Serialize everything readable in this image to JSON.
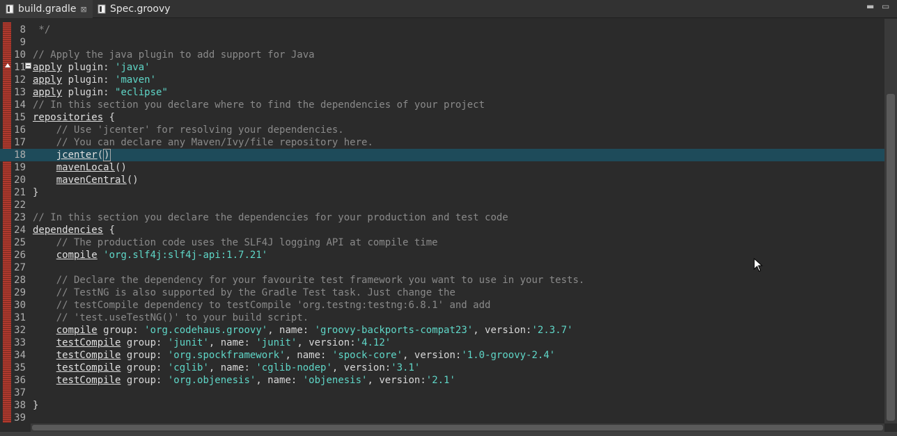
{
  "tabs": [
    {
      "label": "build.gradle",
      "active": true,
      "close": "⊠"
    },
    {
      "label": "Spec.groovy",
      "active": false
    }
  ],
  "window_controls": {
    "minimize": "▬",
    "maximize": "▭"
  },
  "colors": {
    "keyword": "#e0e0e0",
    "string": "#5fd7c8",
    "comment": "#8a8a8a",
    "current_line": "#1e4b5a"
  },
  "lines": [
    {
      "n": "8",
      "tokens": [
        {
          "t": " */",
          "c": "cmt"
        }
      ]
    },
    {
      "n": "9",
      "tokens": []
    },
    {
      "n": "10",
      "tokens": [
        {
          "t": "// Apply the java plugin to add support for Java",
          "c": "cmt"
        }
      ]
    },
    {
      "n": "11",
      "tokens": [
        {
          "t": "apply",
          "c": "kw"
        },
        {
          "t": " plugin: ",
          "c": ""
        },
        {
          "t": "'java'",
          "c": "str"
        }
      ]
    },
    {
      "n": "12",
      "tokens": [
        {
          "t": "apply",
          "c": "kw"
        },
        {
          "t": " plugin: ",
          "c": ""
        },
        {
          "t": "'maven'",
          "c": "str"
        }
      ]
    },
    {
      "n": "13",
      "tokens": [
        {
          "t": "apply",
          "c": "kw"
        },
        {
          "t": " plugin: ",
          "c": ""
        },
        {
          "t": "\"eclipse\"",
          "c": "str"
        }
      ]
    },
    {
      "n": "14",
      "tokens": [
        {
          "t": "// In this section you declare where to find the dependencies of your project",
          "c": "cmt"
        }
      ]
    },
    {
      "n": "15",
      "tokens": [
        {
          "t": "repositories",
          "c": "kw"
        },
        {
          "t": " {",
          "c": ""
        }
      ]
    },
    {
      "n": "16",
      "tokens": [
        {
          "t": "    ",
          "c": ""
        },
        {
          "t": "// Use 'jcenter' for resolving your dependencies.",
          "c": "cmt"
        }
      ]
    },
    {
      "n": "17",
      "tokens": [
        {
          "t": "    ",
          "c": ""
        },
        {
          "t": "// You can declare any Maven/Ivy/file repository here.",
          "c": "cmt"
        }
      ]
    },
    {
      "n": "18",
      "current": true,
      "tokens": [
        {
          "t": "    ",
          "c": ""
        },
        {
          "t": "jcenter",
          "c": "kw"
        },
        {
          "t": "(",
          "c": ""
        },
        {
          "t": ")",
          "c": "cur"
        }
      ]
    },
    {
      "n": "19",
      "tokens": [
        {
          "t": "    ",
          "c": ""
        },
        {
          "t": "mavenLocal",
          "c": "kw"
        },
        {
          "t": "()",
          "c": ""
        }
      ]
    },
    {
      "n": "20",
      "tokens": [
        {
          "t": "    ",
          "c": ""
        },
        {
          "t": "mavenCentral",
          "c": "kw"
        },
        {
          "t": "()",
          "c": ""
        }
      ]
    },
    {
      "n": "21",
      "tokens": [
        {
          "t": "}",
          "c": ""
        }
      ]
    },
    {
      "n": "22",
      "tokens": []
    },
    {
      "n": "23",
      "tokens": [
        {
          "t": "// In this section you declare the dependencies for your production and test code",
          "c": "cmt"
        }
      ]
    },
    {
      "n": "24",
      "tokens": [
        {
          "t": "dependencies",
          "c": "kw"
        },
        {
          "t": " {",
          "c": ""
        }
      ]
    },
    {
      "n": "25",
      "tokens": [
        {
          "t": "    ",
          "c": ""
        },
        {
          "t": "// The production code uses the SLF4J logging API at compile time",
          "c": "cmt"
        }
      ]
    },
    {
      "n": "26",
      "tokens": [
        {
          "t": "    ",
          "c": ""
        },
        {
          "t": "compile",
          "c": "kw"
        },
        {
          "t": " ",
          "c": ""
        },
        {
          "t": "'org.slf4j:slf4j-api:1.7.21'",
          "c": "str"
        }
      ]
    },
    {
      "n": "27",
      "tokens": []
    },
    {
      "n": "28",
      "tokens": [
        {
          "t": "    ",
          "c": ""
        },
        {
          "t": "// Declare the dependency for your favourite test framework you want to use in your tests.",
          "c": "cmt"
        }
      ]
    },
    {
      "n": "29",
      "tokens": [
        {
          "t": "    ",
          "c": ""
        },
        {
          "t": "// TestNG is also supported by the Gradle Test task. Just change the",
          "c": "cmt"
        }
      ]
    },
    {
      "n": "30",
      "tokens": [
        {
          "t": "    ",
          "c": ""
        },
        {
          "t": "// testCompile dependency to testCompile 'org.testng:testng:6.8.1' and add",
          "c": "cmt"
        }
      ]
    },
    {
      "n": "31",
      "tokens": [
        {
          "t": "    ",
          "c": ""
        },
        {
          "t": "// 'test.useTestNG()' to your build script.",
          "c": "cmt"
        }
      ]
    },
    {
      "n": "32",
      "tokens": [
        {
          "t": "    ",
          "c": ""
        },
        {
          "t": "compile",
          "c": "kw"
        },
        {
          "t": " group: ",
          "c": ""
        },
        {
          "t": "'org.codehaus.groovy'",
          "c": "str"
        },
        {
          "t": ", name: ",
          "c": ""
        },
        {
          "t": "'groovy-backports-compat23'",
          "c": "str"
        },
        {
          "t": ", version:",
          "c": ""
        },
        {
          "t": "'2.3.7'",
          "c": "str"
        }
      ]
    },
    {
      "n": "33",
      "tokens": [
        {
          "t": "    ",
          "c": ""
        },
        {
          "t": "testCompile",
          "c": "kw"
        },
        {
          "t": " group: ",
          "c": ""
        },
        {
          "t": "'junit'",
          "c": "str"
        },
        {
          "t": ", name: ",
          "c": ""
        },
        {
          "t": "'junit'",
          "c": "str"
        },
        {
          "t": ", version:",
          "c": ""
        },
        {
          "t": "'4.12'",
          "c": "str"
        }
      ]
    },
    {
      "n": "34",
      "tokens": [
        {
          "t": "    ",
          "c": ""
        },
        {
          "t": "testCompile",
          "c": "kw"
        },
        {
          "t": " group: ",
          "c": ""
        },
        {
          "t": "'org.spockframework'",
          "c": "str"
        },
        {
          "t": ", name: ",
          "c": ""
        },
        {
          "t": "'spock-core'",
          "c": "str"
        },
        {
          "t": ", version:",
          "c": ""
        },
        {
          "t": "'1.0-groovy-2.4'",
          "c": "str"
        }
      ]
    },
    {
      "n": "35",
      "tokens": [
        {
          "t": "    ",
          "c": ""
        },
        {
          "t": "testCompile",
          "c": "kw"
        },
        {
          "t": " group: ",
          "c": ""
        },
        {
          "t": "'cglib'",
          "c": "str"
        },
        {
          "t": ", name: ",
          "c": ""
        },
        {
          "t": "'cglib-nodep'",
          "c": "str"
        },
        {
          "t": ", version:",
          "c": ""
        },
        {
          "t": "'3.1'",
          "c": "str"
        }
      ]
    },
    {
      "n": "36",
      "tokens": [
        {
          "t": "    ",
          "c": ""
        },
        {
          "t": "testCompile",
          "c": "kw"
        },
        {
          "t": " group: ",
          "c": ""
        },
        {
          "t": "'org.objenesis'",
          "c": "str"
        },
        {
          "t": ", name: ",
          "c": ""
        },
        {
          "t": "'objenesis'",
          "c": "str"
        },
        {
          "t": ", version:",
          "c": ""
        },
        {
          "t": "'2.1'",
          "c": "str"
        }
      ]
    },
    {
      "n": "37",
      "tokens": []
    },
    {
      "n": "38",
      "tokens": [
        {
          "t": "}",
          "c": ""
        }
      ]
    },
    {
      "n": "39",
      "tokens": []
    }
  ]
}
